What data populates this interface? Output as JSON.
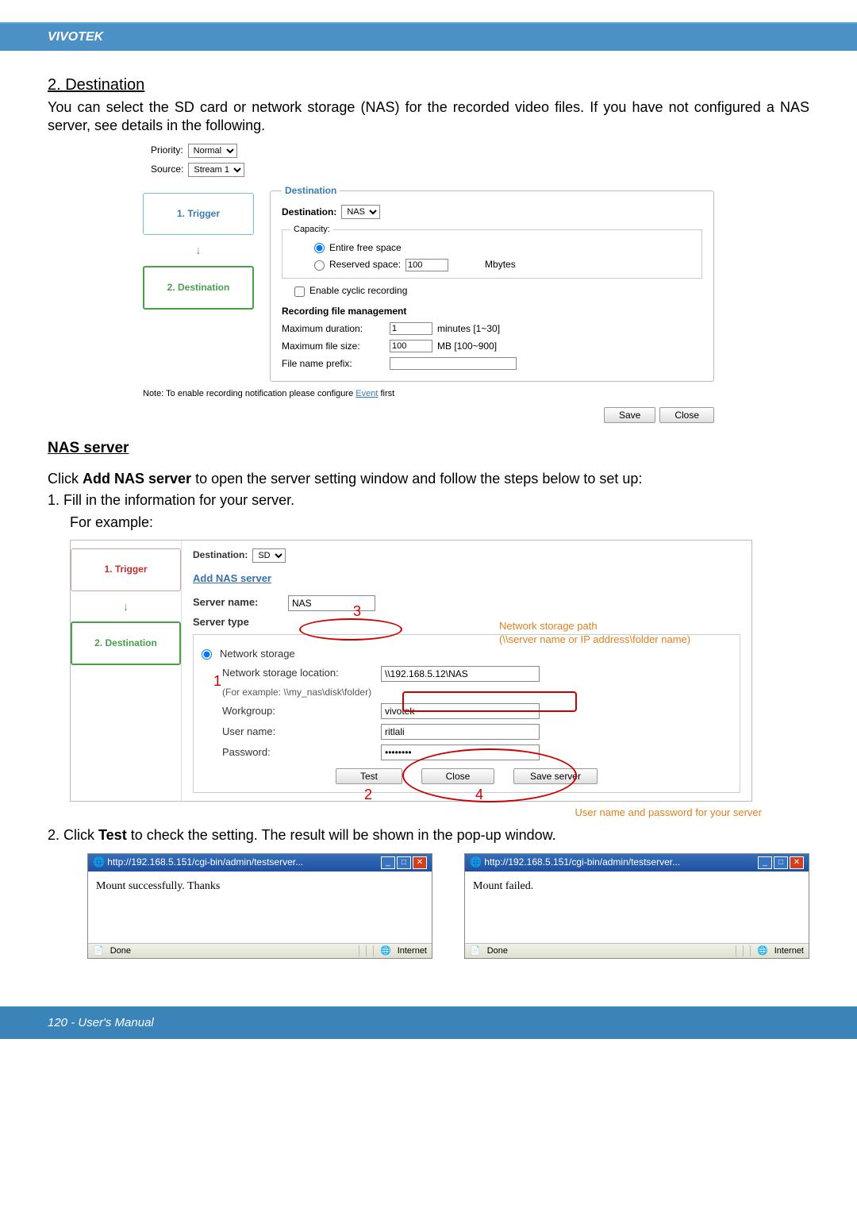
{
  "header": {
    "brand": "VIVOTEK"
  },
  "section1": {
    "title": "2. Destination",
    "body": "You can select the SD card or network storage (NAS) for the recorded video files. If you have not configured a NAS server, see details in the following."
  },
  "img1": {
    "priority_label": "Priority:",
    "priority_value": "Normal",
    "source_label": "Source:",
    "source_value": "Stream 1",
    "step1": "1.  Trigger",
    "step2": "2.  Destination",
    "fs_title": "Destination",
    "dest_label": "Destination:",
    "dest_value": "NAS",
    "capacity_label": "Capacity:",
    "cap_entire": "Entire free space",
    "cap_reserved": "Reserved space:",
    "cap_reserved_val": "100",
    "cap_reserved_unit": "Mbytes",
    "cyclic": "Enable cyclic recording",
    "rfm": "Recording file management",
    "maxdur_label": "Maximum duration:",
    "maxdur_val": "1",
    "maxdur_unit": "minutes [1~30]",
    "maxfs_label": "Maximum file size:",
    "maxfs_val": "100",
    "maxfs_unit": "MB [100~900]",
    "fnprefix": "File name prefix:",
    "note_prefix": "Note: To enable recording notification please configure ",
    "note_link": "Event",
    "note_suffix": " first",
    "save": "Save",
    "close": "Close"
  },
  "nas": {
    "title": "NAS server",
    "intro_prefix": "Click ",
    "intro_bold": "Add NAS server",
    "intro_suffix": " to open the server setting window and follow the steps below to set up:",
    "step1": "1. Fill in the information for your server.",
    "step1b": "For example:"
  },
  "img2": {
    "step1": "1.  Trigger",
    "step2": "2.  Destination",
    "dest_label": "Destination:",
    "dest_value": "SD",
    "addnas": "Add NAS server",
    "server_name_label": "Server name:",
    "server_name_val": "NAS",
    "server_type": "Server type",
    "radio_ns": "Network storage",
    "nsl_label": "Network storage location:",
    "nsl_val": "\\\\192.168.5.12\\NAS",
    "nsl_example": "(For example: \\\\my_nas\\disk\\folder)",
    "wg_label": "Workgroup:",
    "wg_val": "vivotek",
    "un_label": "User name:",
    "un_val": "ritlali",
    "pw_label": "Password:",
    "pw_val": "••••••••",
    "test": "Test",
    "close": "Close",
    "save": "Save server",
    "annot_path_title": "Network storage path",
    "annot_path_body": "(\\\\server name or IP address\\folder name)",
    "annot_user": "User name and password for your server",
    "n1": "1",
    "n2": "2",
    "n3": "3",
    "n4": "4"
  },
  "step2_text_prefix": "2. Click ",
  "step2_text_bold": "Test",
  "step2_text_suffix": " to check the setting. The result will be shown in the pop-up window.",
  "popup": {
    "url": "http://192.168.5.151/cgi-bin/admin/testserver...",
    "success": "Mount successfully. Thanks",
    "fail": "Mount failed.",
    "done": "Done",
    "internet": "Internet"
  },
  "footer": {
    "pageinfo": "120 - User's Manual"
  }
}
